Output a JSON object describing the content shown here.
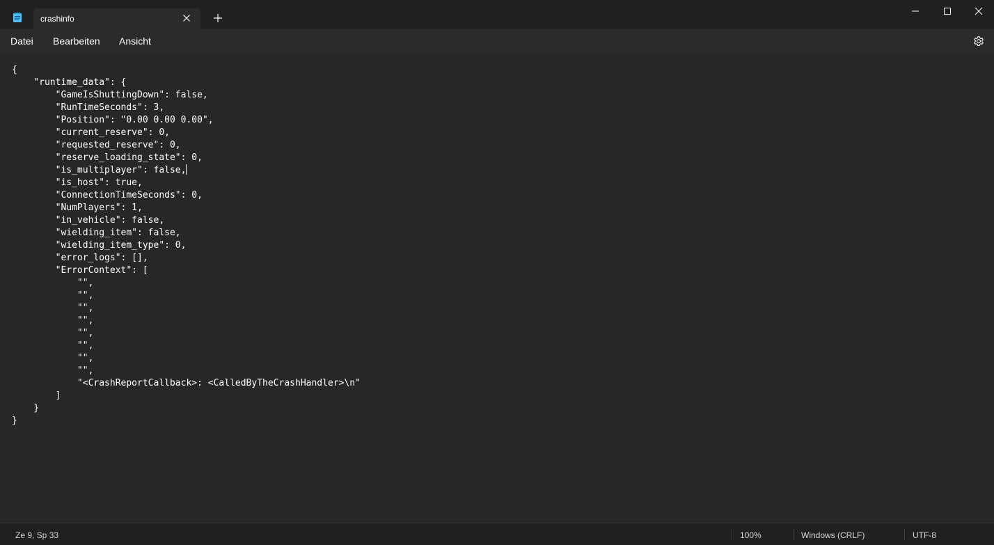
{
  "window": {
    "tab_title": "crashinfo",
    "icons": {
      "app": "notepad-icon",
      "close_tab": "close-icon",
      "new_tab": "plus-icon",
      "minimize": "minimize-icon",
      "maximize": "maximize-icon",
      "close": "close-icon",
      "settings": "gear-icon"
    }
  },
  "menu": {
    "file": "Datei",
    "edit": "Bearbeiten",
    "view": "Ansicht"
  },
  "editor": {
    "caret_line": 9,
    "lines": [
      "{",
      "    \"runtime_data\": {",
      "        \"GameIsShuttingDown\": false,",
      "        \"RunTimeSeconds\": 3,",
      "        \"Position\": \"0.00 0.00 0.00\",",
      "        \"current_reserve\": 0,",
      "        \"requested_reserve\": 0,",
      "        \"reserve_loading_state\": 0,",
      "        \"is_multiplayer\": false,",
      "        \"is_host\": true,",
      "        \"ConnectionTimeSeconds\": 0,",
      "        \"NumPlayers\": 1,",
      "        \"in_vehicle\": false,",
      "        \"wielding_item\": false,",
      "        \"wielding_item_type\": 0,",
      "        \"error_logs\": [],",
      "        \"ErrorContext\": [",
      "            \"\",",
      "            \"\",",
      "            \"\",",
      "            \"\",",
      "            \"\",",
      "            \"\",",
      "            \"\",",
      "            \"\",",
      "            \"<CrashReportCallback>: <CalledByTheCrashHandler>\\n\"",
      "        ]",
      "    }",
      "}"
    ]
  },
  "status": {
    "position": "Ze 9, Sp 33",
    "zoom": "100%",
    "line_ending": "Windows (CRLF)",
    "encoding": "UTF-8"
  },
  "colors": {
    "titlebar": "#202020",
    "menubar": "#2b2b2b",
    "editor_bg": "#272727",
    "text": "#ffffff",
    "app_icon": "#4cc2ff"
  }
}
